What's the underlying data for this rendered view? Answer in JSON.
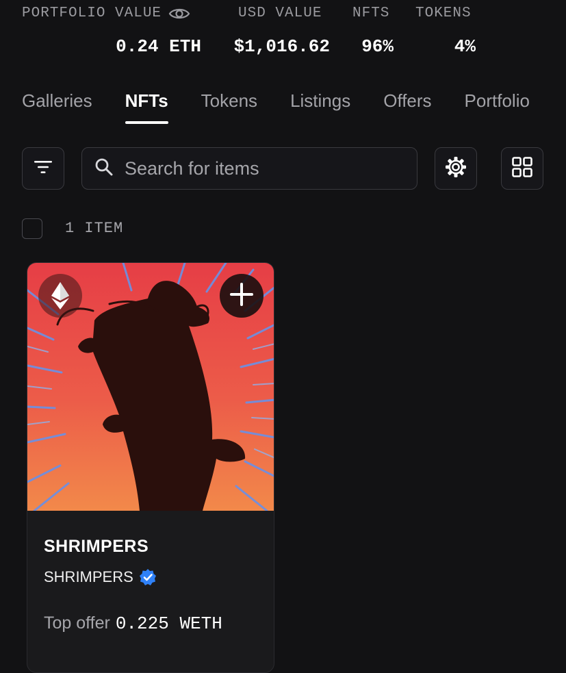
{
  "stats": {
    "portfolio_label": "PORTFOLIO VALUE",
    "portfolio_value": "0.24 ETH",
    "usd_label": "USD VALUE",
    "usd_value": "$1,016.62",
    "nfts_label": "NFTS",
    "nfts_value": "96%",
    "tokens_label": "TOKENS",
    "tokens_value": "4%",
    "visibility_icon": "eye-icon"
  },
  "tabs": [
    {
      "label": "Galleries",
      "active": false
    },
    {
      "label": "NFTs",
      "active": true
    },
    {
      "label": "Tokens",
      "active": false
    },
    {
      "label": "Listings",
      "active": false
    },
    {
      "label": "Offers",
      "active": false
    },
    {
      "label": "Portfolio",
      "active": false
    }
  ],
  "toolbar": {
    "filter_icon": "filter-icon",
    "search_placeholder": "Search for items",
    "search_icon": "search-icon",
    "settings_icon": "gear-icon",
    "view_icon": "grid-view-icon"
  },
  "items": {
    "count_label": "1 ITEM"
  },
  "card": {
    "title": "SHRIMPERS",
    "collection": "SHRIMPERS",
    "verified": true,
    "offer_label": "Top offer",
    "offer_value": "0.225 WETH",
    "chain_icon": "ethereum-icon",
    "add_icon": "plus-icon"
  },
  "colors": {
    "background": "#121214",
    "accent_verified": "#2f81f7",
    "image_red": "#e8454a",
    "image_orange": "#f0814a",
    "ray_blue": "#6f8fe0",
    "silhouette": "#2a0f0c"
  }
}
